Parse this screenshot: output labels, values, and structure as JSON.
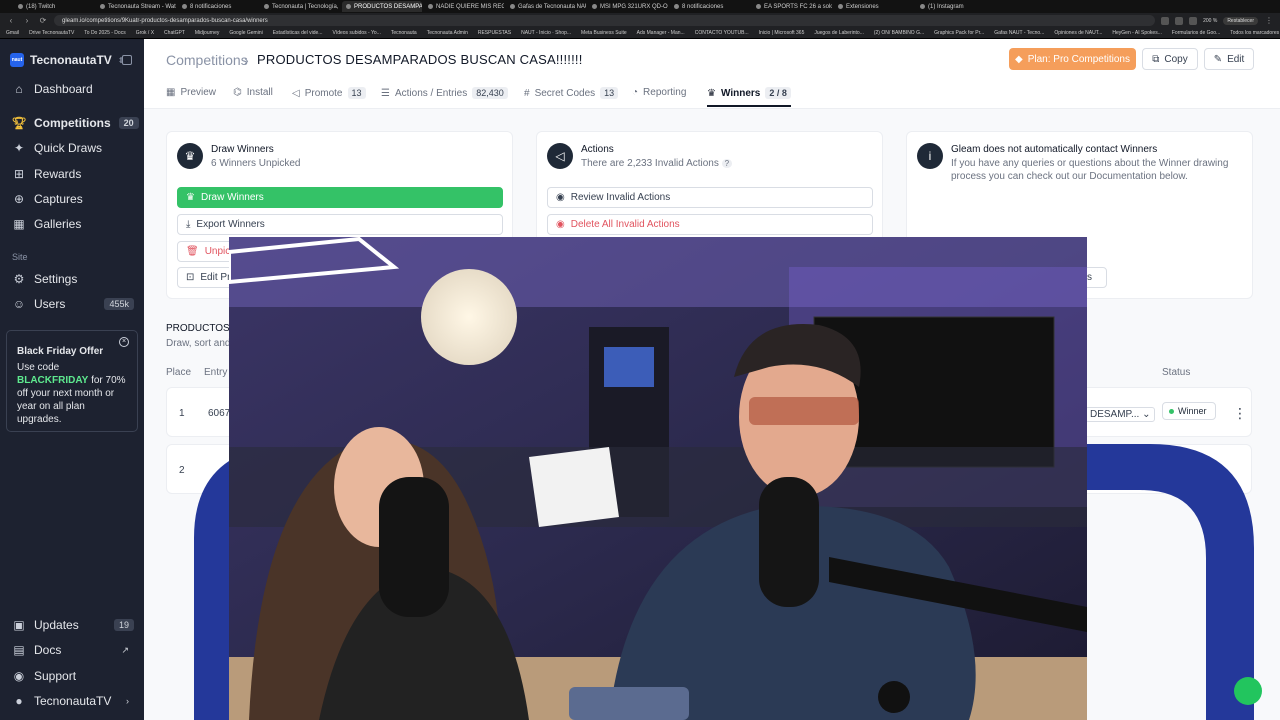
{
  "browser": {
    "tabs": [
      "(18) Twitch",
      "Tecnonauta Stream - Watch L",
      "8 notificaciones",
      "Tecnonauta | Tecnología, noti",
      "PRODUCTOS DESAMPARADO",
      "NADIE QUIERE MIS REGALOS!",
      "Gafas de Tecnonauta NAUT",
      "MSI MPG 321URX QD-OLED",
      "8 notificaciones",
      "EA SPORTS FC 26 a solo 10,5",
      "Extensiones",
      "(1) Instagram"
    ],
    "url": "gleam.io/competitions/9Kuatr-productos-desamparados-buscan-casa/winners",
    "zoom": "200 %",
    "restore_label": "Restablecer",
    "bookmarks": [
      "Gmail",
      "Drive TecnonautaTV",
      "To Do 2025 - Docs",
      "Grok / X",
      "ChatGPT",
      "Midjourney",
      "Google Gemini",
      "Estadísticas del vide...",
      "Vídeos subidos - Yo...",
      "Tecnonauta",
      "Tecnonauta Admin",
      "RESPUESTAS",
      "NAUT - Inicio · Shop...",
      "Meta Business Suite",
      "Ads Manager - Man...",
      "CONTACTO YOUTUB...",
      "Inicio | Microsoft 365",
      "Juegos de Laberinto...",
      "(2) ON/ BAMBINO G...",
      "Graphics Pack for Pr...",
      "Gafas NAUT - Tecno...",
      "Opiniones de NAUT...",
      "HeyGen - AI Spokes...",
      "Formularios de Goo..."
    ],
    "all_bookmarks": "Todos los marcadores"
  },
  "sidebar": {
    "brand": "TecnonautaTV",
    "logo_text": "naut",
    "items": [
      {
        "label": "Dashboard",
        "icon": "home-icon"
      },
      {
        "label": "Competitions",
        "icon": "trophy-icon",
        "badge": "20"
      },
      {
        "label": "Quick Draws",
        "icon": "quick-draw-icon"
      },
      {
        "label": "Rewards",
        "icon": "gift-icon"
      },
      {
        "label": "Captures",
        "icon": "capture-icon"
      },
      {
        "label": "Galleries",
        "icon": "gallery-icon"
      }
    ],
    "site_section": "Site",
    "site_items": [
      {
        "label": "Settings",
        "icon": "gear-icon"
      },
      {
        "label": "Users",
        "icon": "users-icon",
        "badge": "455k"
      }
    ],
    "promo": {
      "title": "Black Friday Offer",
      "pre": "Use code ",
      "code": "BLACKFRIDAY",
      "post": " for 70% off your next month or year on all plan upgrades."
    },
    "bottom_items": [
      {
        "label": "Updates",
        "icon": "updates-icon",
        "badge": "19"
      },
      {
        "label": "Docs",
        "icon": "docs-icon"
      },
      {
        "label": "Support",
        "icon": "support-icon"
      },
      {
        "label": "TecnonautaTV",
        "icon": "account-icon"
      }
    ]
  },
  "header": {
    "breadcrumb_link": "Competitions",
    "title": "PRODUCTOS DESAMPARADOS BUSCAN CASA!!!!!!!",
    "plan_button": "Plan: Pro Competitions",
    "copy_button": "Copy",
    "edit_button": "Edit"
  },
  "tabs": [
    {
      "label": "Preview",
      "icon": "preview-icon"
    },
    {
      "label": "Install",
      "icon": "install-icon"
    },
    {
      "label": "Promote",
      "icon": "megaphone-icon",
      "count": "13"
    },
    {
      "label": "Actions / Entries",
      "icon": "list-icon",
      "count": "82,430"
    },
    {
      "label": "Secret Codes",
      "icon": "code-icon",
      "count": "13"
    },
    {
      "label": "Reporting",
      "icon": "chart-icon"
    },
    {
      "label": "Winners",
      "icon": "trophy-icon",
      "count": "2 / 8",
      "active": true
    }
  ],
  "cards": {
    "draw": {
      "title": "Draw Winners",
      "subtitle": "6 Winners Unpicked",
      "draw_button": "Draw Winners",
      "export_button": "Export Winners",
      "unpick_button": "Unpick",
      "edit_prizes_button": "Edit Pri"
    },
    "actions": {
      "title": "Actions",
      "subtitle": "There are 2,233 Invalid Actions",
      "review_button": "Review Invalid Actions",
      "delete_button": "Delete All Invalid Actions"
    },
    "info": {
      "title": "Gleam does not automatically contact Winners",
      "body": "If you have any queries or questions about the Winner drawing process you can check out our Documentation below.",
      "button_partial": "vs"
    }
  },
  "winners_table": {
    "section_title": "PRODUCTOS D",
    "section_sub": "Draw, sort and d",
    "columns": [
      "Place",
      "Entry",
      "Status"
    ],
    "rows": [
      {
        "place": "1",
        "entry": "6067",
        "prize": "DESAMP...",
        "status": "Winner"
      },
      {
        "place": "2"
      }
    ]
  },
  "colors": {
    "sidebar_bg": "#1d2230",
    "accent_orange": "#f59e5b",
    "accent_green": "#34c267",
    "danger": "#e1545f",
    "video_overlay_bg": "#2a2446"
  }
}
